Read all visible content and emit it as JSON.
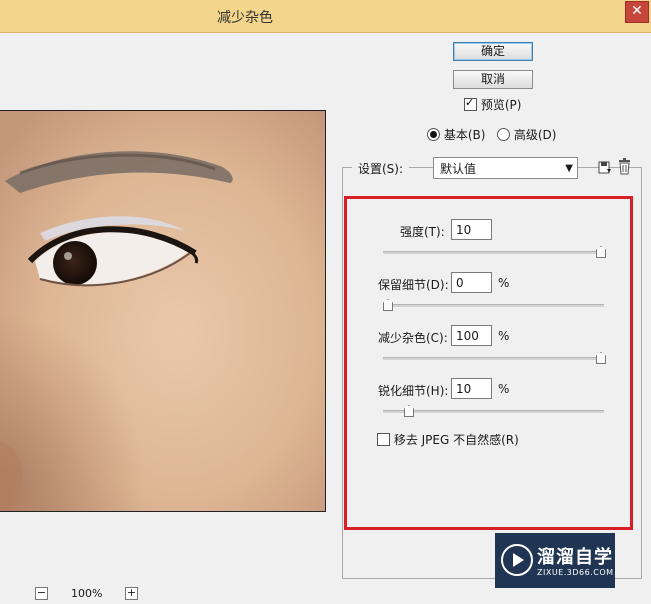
{
  "window": {
    "title": "减少杂色",
    "close_glyph": "✕"
  },
  "buttons": {
    "ok": "确定",
    "cancel": "取消"
  },
  "preview": {
    "checked": true,
    "label": "预览(P)"
  },
  "mode": {
    "basic": {
      "label": "基本(B)",
      "selected": true
    },
    "advanced": {
      "label": "高级(D)",
      "selected": false
    }
  },
  "settings": {
    "label": "设置(S):",
    "value": "默认值",
    "save_icon": "save-settings-icon",
    "delete_icon": "trash-icon"
  },
  "params": {
    "strength": {
      "label": "强度(T):",
      "value": "10",
      "fraction": 1.0
    },
    "preserve": {
      "label": "保留细节(D):",
      "value": "0",
      "unit": "%",
      "fraction": 0.0
    },
    "reduce": {
      "label": "减少杂色(C):",
      "value": "100",
      "unit": "%",
      "fraction": 1.0
    },
    "sharpen": {
      "label": "锐化细节(H):",
      "value": "10",
      "unit": "%",
      "fraction": 0.1
    }
  },
  "jpeg": {
    "checked": false,
    "label": "移去 JPEG 不自然感(R)"
  },
  "zoom": {
    "level": "100%",
    "minus": "−",
    "plus": "+"
  },
  "watermark": {
    "brand": "溜溜自学",
    "url": "ZIXUE.3D66.COM"
  },
  "colors": {
    "titlebar": "#f3d58c",
    "highlight": "#d81e27",
    "watermark_bg": "#1f3553"
  }
}
